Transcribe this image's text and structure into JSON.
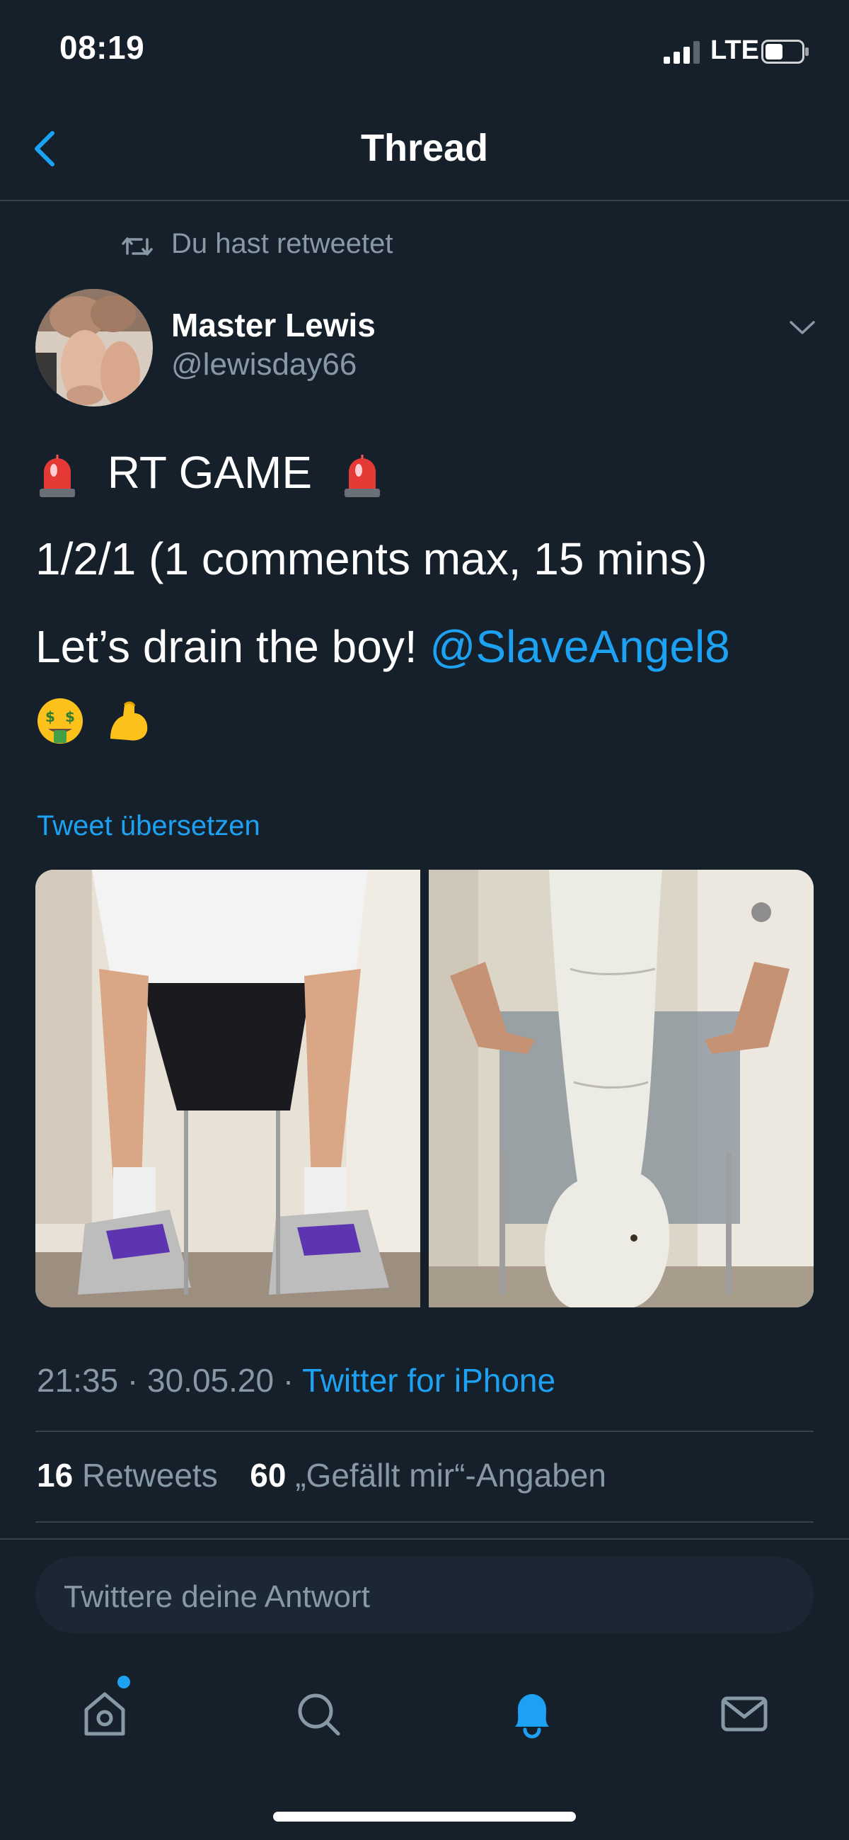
{
  "status_bar": {
    "time": "08:19",
    "network": "LTE"
  },
  "nav": {
    "title": "Thread"
  },
  "retweet": {
    "text": "Du hast retweetet"
  },
  "author": {
    "name": "Master Lewis",
    "handle": "@lewisday66"
  },
  "tweet": {
    "line1": "RT GAME",
    "line2": "1/2/1  (1 comments max, 15 mins)",
    "line3_prefix": "Let’s drain the boy! ",
    "mention": "@SlaveAngel8",
    "emojis": [
      "money-mouth-face-emoji",
      "flexed-biceps-emoji"
    ],
    "siren_icon": "police-light-emoji"
  },
  "translate": {
    "label": "Tweet übersetzen"
  },
  "meta": {
    "time": "21:35",
    "date": "30.05.20",
    "source": "Twitter for iPhone"
  },
  "stats": {
    "retweets_count": "16",
    "retweets_label": "Retweets",
    "likes_count": "60",
    "likes_label": "„Gefällt mir“-Angaben"
  },
  "reply": {
    "placeholder": "Twittere deine Antwort"
  },
  "tabs": [
    {
      "icon": "home-icon"
    },
    {
      "icon": "search-icon"
    },
    {
      "icon": "bell-icon"
    },
    {
      "icon": "mail-icon"
    }
  ],
  "colors": {
    "background": "#15202b",
    "accent": "#1da1f2",
    "muted": "#8899a6",
    "divider": "#38444d"
  }
}
